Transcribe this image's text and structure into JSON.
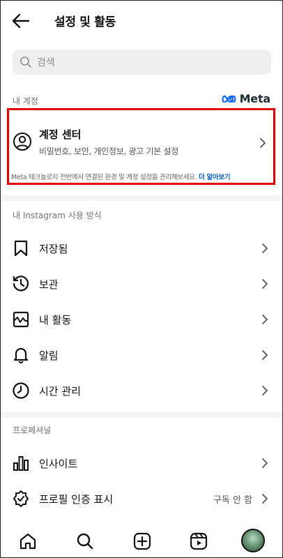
{
  "header": {
    "title": "설정 및 활동"
  },
  "search": {
    "placeholder": "검색"
  },
  "account_section": {
    "label": "내 계정",
    "brand": "Meta",
    "card": {
      "title": "계정 센터",
      "subtitle": "비밀번호, 보안, 개인정보, 광고 기본 설정",
      "note": "Meta 테크놀로지 전반에서 연결된 환경 및 계정 설정을 관리해보세요.",
      "note_link": "더 알아보기"
    }
  },
  "usage_section": {
    "label": "내 Instagram 사용 방식",
    "items": [
      {
        "label": "저장됨",
        "icon": "bookmark-icon"
      },
      {
        "label": "보관",
        "icon": "archive-history-icon"
      },
      {
        "label": "내 활동",
        "icon": "activity-icon"
      },
      {
        "label": "알림",
        "icon": "bell-icon"
      },
      {
        "label": "시간 관리",
        "icon": "clock-icon"
      }
    ]
  },
  "pro_section": {
    "label": "프로페셔널",
    "items": [
      {
        "label": "인사이트",
        "icon": "insights-bar-chart-icon"
      },
      {
        "label": "프로필 인증 표시",
        "icon": "verified-badge-icon",
        "value": "구독 안 함"
      }
    ]
  },
  "tabbar": {
    "items": [
      "home-icon",
      "search-icon",
      "create-plus-icon",
      "reels-icon",
      "profile-avatar"
    ]
  }
}
